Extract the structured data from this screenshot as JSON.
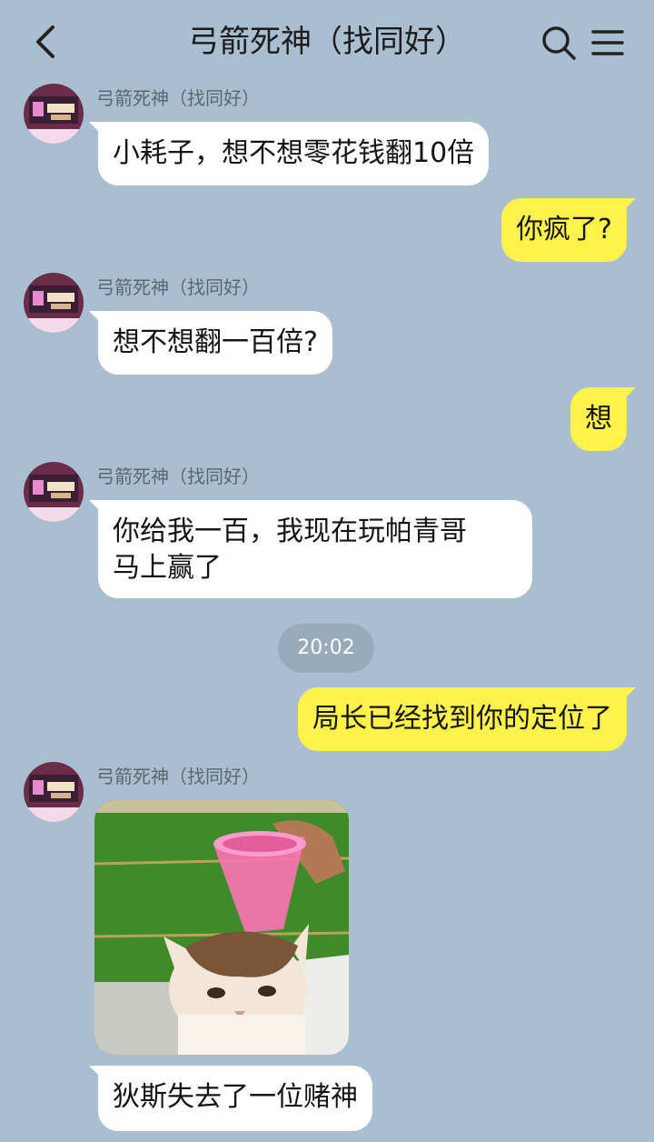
{
  "header": {
    "title": "弓箭死神（找同好）",
    "icons": [
      "chevron-left-icon",
      "search-icon",
      "menu-icon"
    ]
  },
  "messages": [
    {
      "side": "in",
      "sender": "弓箭死神（找同好）",
      "text": "小耗子，想不想零花钱翻10倍"
    },
    {
      "side": "out",
      "text": "你疯了?"
    },
    {
      "side": "in",
      "sender": "弓箭死神（找同好）",
      "text": "想不想翻一百倍?"
    },
    {
      "side": "out",
      "text": "想"
    },
    {
      "side": "in",
      "sender": "弓箭死神（找同好）",
      "text": "你给我一百，我现在玩帕青哥\n马上赢了"
    },
    {
      "side": "out",
      "text": "局长已经找到你的定位了"
    },
    {
      "side": "in",
      "sender": "弓箭死神（找同好）",
      "type": "sticker",
      "image": "cat-with-pink-cup-sticker"
    },
    {
      "side": "in",
      "text": "狄斯失去了一位赌神"
    }
  ],
  "time_divider": "20:02",
  "colors": {
    "background": "#a9bfd1",
    "incoming_bubble": "#ffffff",
    "outgoing_bubble": "#fff24a",
    "time_pill": "#97abbc"
  }
}
